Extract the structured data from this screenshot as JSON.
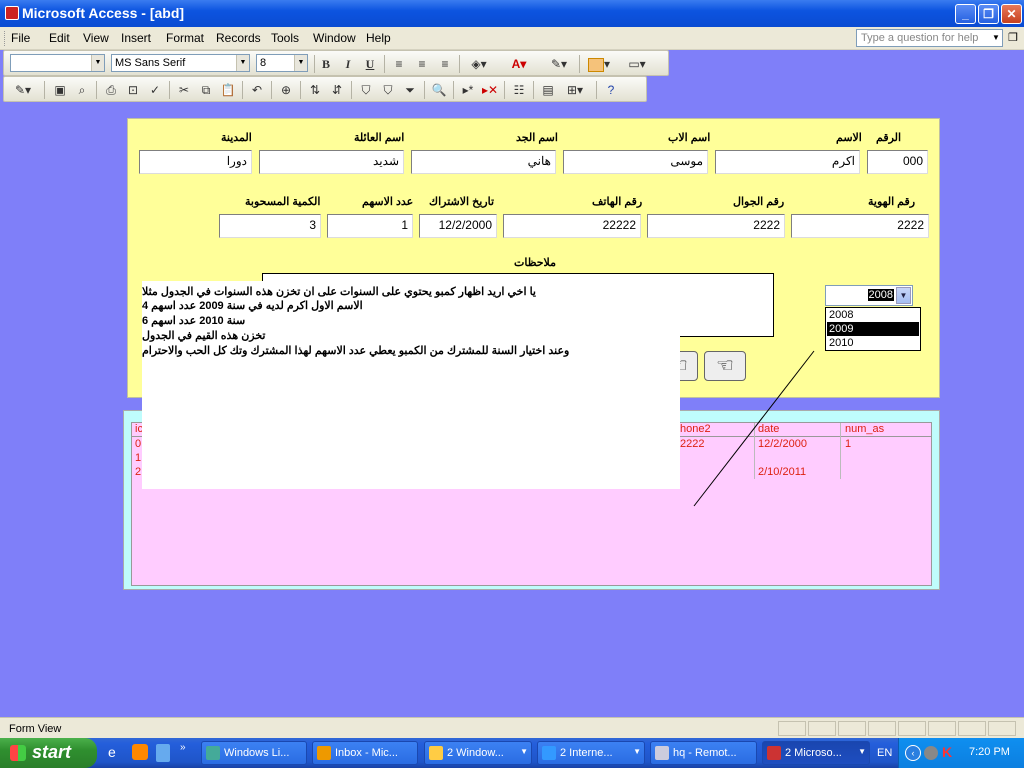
{
  "window": {
    "title": "Microsoft Access - [abd]"
  },
  "menu": {
    "items": [
      "File",
      "Edit",
      "View",
      "Insert",
      "Format",
      "Records",
      "Tools",
      "Window",
      "Help"
    ],
    "help_placeholder": "Type a question for help"
  },
  "toolbar": {
    "font_name": "MS Sans Serif",
    "font_size": "8",
    "bold": "B",
    "italic": "I",
    "underline": "U"
  },
  "form": {
    "labels": {
      "id": "الرقم",
      "name": "الاسم",
      "father": "اسم الاب",
      "grandfather": "اسم الجد",
      "family": "اسم العائلة",
      "city": "المدينة",
      "national_id": "رقم الهوية",
      "mobile": "رقم الجوال",
      "phone": "رقم الهاتف",
      "subscription_date": "تاريخ الاشتراك",
      "shares": "عدد الاسهم",
      "quantity": "الكمية المسحوبة",
      "notes": "ملاحظات"
    },
    "values": {
      "id": "000",
      "name": "اكرم",
      "father": "موسى",
      "grandfather": "هاني",
      "family": "شديد",
      "city": "دورا",
      "national_id": "2222",
      "mobile": "2222",
      "phone": "22222",
      "subscription_date": "12/2/2000",
      "shares": "1",
      "quantity": "3"
    },
    "combo": {
      "value": "2008",
      "options": [
        "2008",
        "2009",
        "2010"
      ],
      "selected": "2009"
    }
  },
  "datasheet": {
    "columns": [
      "ic",
      "hone2",
      "date",
      "num_as"
    ],
    "rows": [
      {
        "id": "0",
        "phone2": "2222",
        "date": "12/2/2000",
        "num_as": "1"
      },
      {
        "id": "1",
        "phone2": "",
        "date": "",
        "num_as": ""
      },
      {
        "id": "2",
        "phone2": "",
        "date": "2/10/2011",
        "num_as": ""
      }
    ]
  },
  "message": {
    "lines": [
      "يا اخي اريد اظهار كمبو يحتوي على السنوات على ان تخزن هذه السنوات في الجدول مثلا",
      "الاسم الاول اكرم  لديه في سنة 2009   عدد اسهم 4",
      "سنة 2010 عدد اسهم 6",
      "تخزن هذه القيم في الجدول",
      "وعند اختيار السنة للمشترك من الكمبو يعطي عدد الاسهم لهذا المشترك وتك كل الحب والاحترام"
    ]
  },
  "status": {
    "text": "Form View"
  },
  "taskbar": {
    "start": "start",
    "tasks": [
      "Windows Li...",
      "Inbox - Mic...",
      "2 Window...",
      "2 Interne...",
      "hq - Remot...",
      "2 Microso..."
    ],
    "lang": "EN",
    "time": "7:20 PM"
  }
}
